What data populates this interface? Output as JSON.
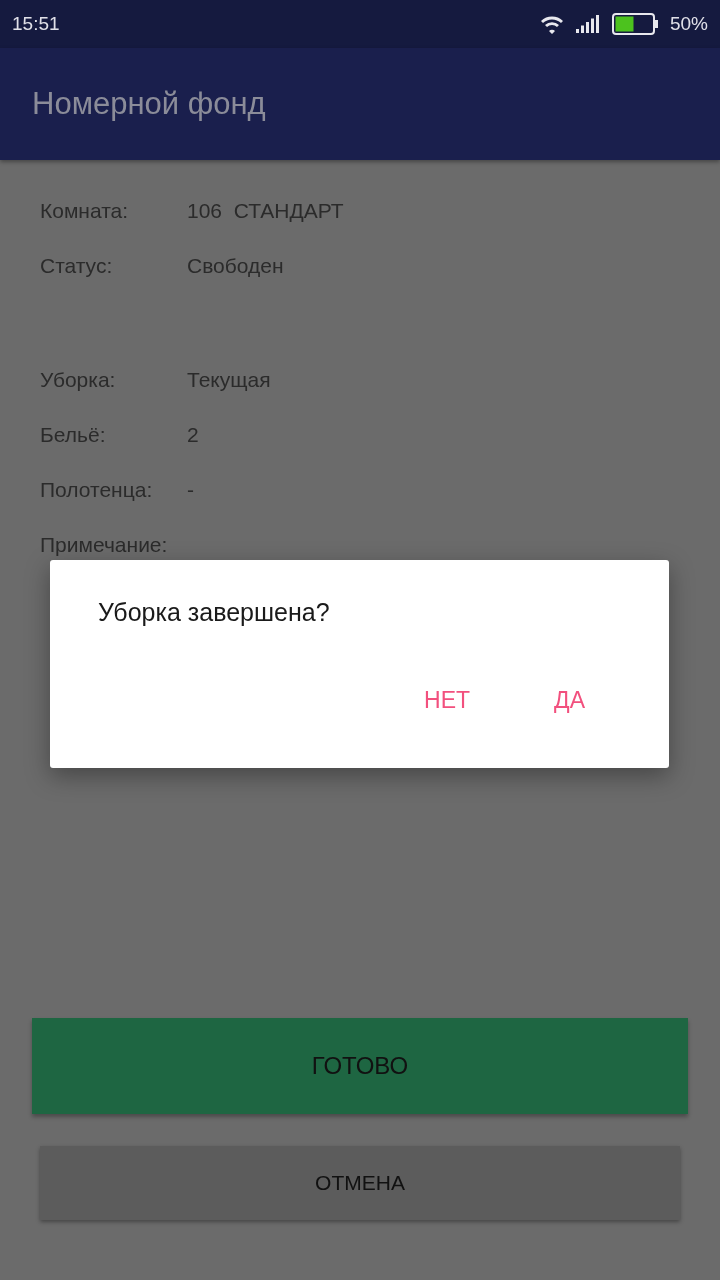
{
  "status_bar": {
    "time": "15:51",
    "battery": "50%"
  },
  "app_bar": {
    "title": "Номерной фонд"
  },
  "groups": [
    {
      "rows": [
        {
          "label": "Комната:",
          "value": "106  СТАНДАРТ"
        },
        {
          "label": "Статус:",
          "value": "Свободен"
        }
      ]
    },
    {
      "rows": [
        {
          "label": "Уборка:",
          "value": "Текущая"
        },
        {
          "label": "Бельё:",
          "value": "2"
        },
        {
          "label": "Полотенца:",
          "value": "-"
        },
        {
          "label": "Примечание:"
        }
      ]
    }
  ],
  "buttons": [
    {
      "label": "ГОТОВО",
      "kind": "primary"
    },
    {
      "label": "ОТМЕНА",
      "kind": "secondary"
    }
  ],
  "dialog": {
    "message": "Уборка завершена?",
    "actions": [
      "НЕТ",
      "ДА"
    ]
  }
}
